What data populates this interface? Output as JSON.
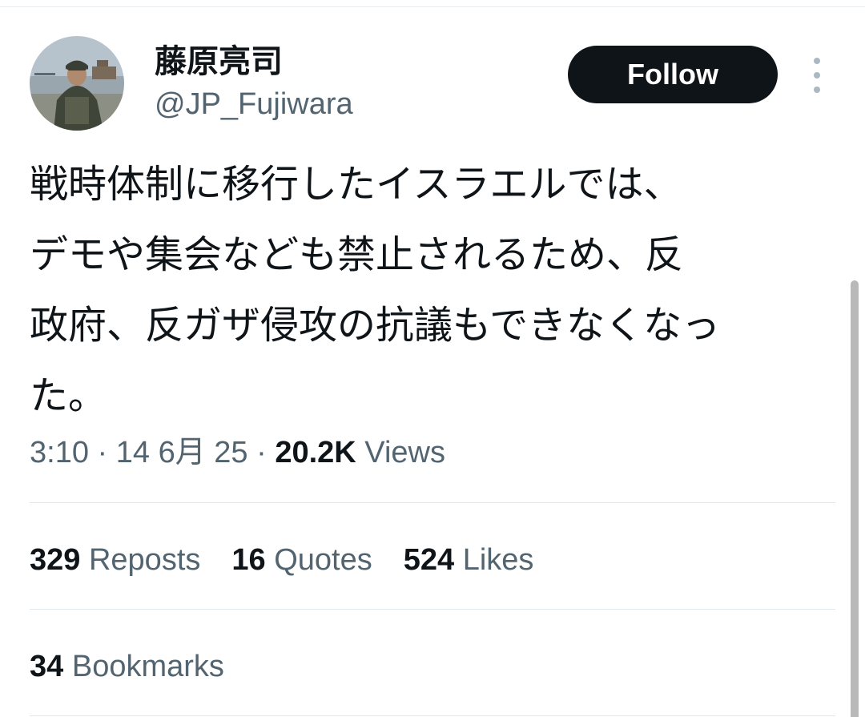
{
  "user": {
    "display_name": "藤原亮司",
    "handle": "@JP_Fujiwara",
    "avatar_icon": "profile-photo-avatar"
  },
  "actions": {
    "follow_label": "Follow",
    "more_icon": "more-vertical-icon"
  },
  "tweet": {
    "text": "戦時体制に移行したイスラエルでは、\nデモや集会なども禁止されるため、反\n政府、反ガザ侵攻の抗議もできなくなっ\nた。"
  },
  "meta": {
    "time": "3:10",
    "date": "14 6月 25",
    "separator": " · ",
    "views_count": "20.2K",
    "views_label": "Views"
  },
  "stats": {
    "reposts_count": "329",
    "reposts_label": "Reposts",
    "quotes_count": "16",
    "quotes_label": "Quotes",
    "likes_count": "524",
    "likes_label": "Likes",
    "bookmarks_count": "34",
    "bookmarks_label": "Bookmarks"
  },
  "colors": {
    "text_primary": "#0f1419",
    "text_secondary": "#536471",
    "button_bg": "#0f1419",
    "divider": "#e1e8ed"
  }
}
